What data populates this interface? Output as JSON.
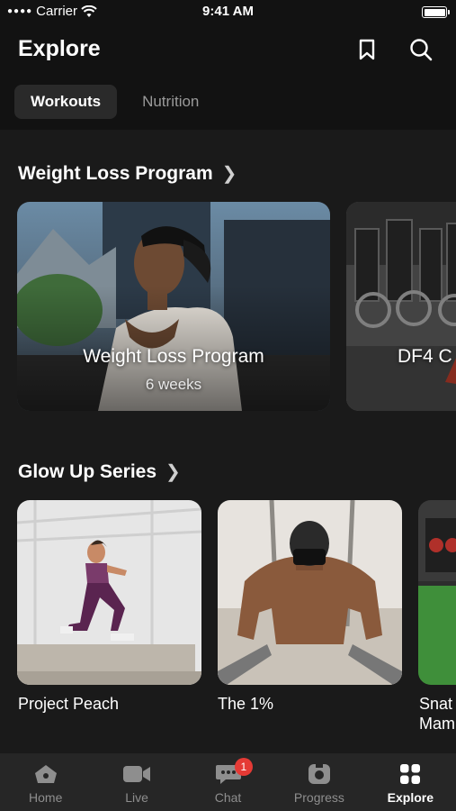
{
  "status_bar": {
    "carrier": "Carrier",
    "time": "9:41 AM",
    "battery_level": 0.95
  },
  "header": {
    "title": "Explore",
    "icons": {
      "bookmark": "bookmark-icon",
      "search": "search-icon"
    },
    "tabs": [
      {
        "label": "Workouts",
        "active": true
      },
      {
        "label": "Nutrition",
        "active": false
      }
    ]
  },
  "sections": [
    {
      "title": "Weight Loss Program",
      "cards": [
        {
          "title": "Weight Loss Program",
          "subtitle": "6 weeks"
        },
        {
          "title": "DF4 C"
        }
      ]
    },
    {
      "title": "Glow Up Series",
      "cards": [
        {
          "label": "Project Peach"
        },
        {
          "label": "The 1%"
        },
        {
          "label": "Snat Mam"
        }
      ]
    }
  ],
  "tabbar": {
    "items": [
      {
        "label": "Home",
        "icon": "home-icon"
      },
      {
        "label": "Live",
        "icon": "video-icon"
      },
      {
        "label": "Chat",
        "icon": "chat-icon",
        "badge": "1"
      },
      {
        "label": "Progress",
        "icon": "camera-icon"
      },
      {
        "label": "Explore",
        "icon": "grid-icon",
        "active": true
      }
    ]
  },
  "colors": {
    "background": "#121212",
    "tab_bar": "#262626",
    "badge": "#e53a35",
    "active_tab": "#2a2a2a"
  }
}
